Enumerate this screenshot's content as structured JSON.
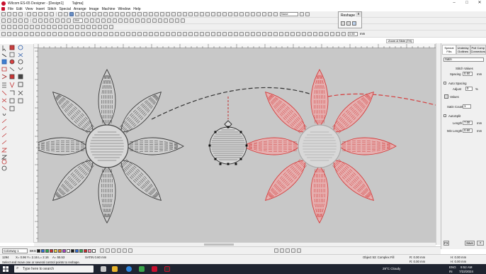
{
  "window": {
    "title": "Wilcom ES-65 Designer - [Design1]",
    "tab": "Tajima]"
  },
  "menu": [
    "File",
    "Edit",
    "View",
    "Insert",
    "Stitch",
    "Special",
    "Arrange",
    "Image",
    "Machine",
    "Window",
    "Help"
  ],
  "toolbar": {
    "mode_select": "None",
    "zoom_value": "254",
    "width_value": "0.50",
    "width_unit": "mm"
  },
  "reshape_toolbar": {
    "title": "Reshape",
    "close": "x"
  },
  "docker": {
    "top_tabs": [
      "Zoom & Slide (TH)",
      ""
    ],
    "tabs": [
      "Special Fills",
      "Underlay Outlines",
      "Pull Comp Connectors"
    ],
    "fill_type": "Satin",
    "section_stitch_values": "Stitch Values",
    "spacing_label": "Spacing",
    "spacing_value": "0.50",
    "spacing_unit": "mm",
    "auto_spacing_label": "Auto Spacing",
    "adjust_label": "Adjust",
    "adjust_value": "0",
    "adjust_unit": "%",
    "values_label": "Values",
    "satin_count_label": "Satin Count",
    "satin_count_value": "1",
    "autosplit_label": "AutoSplit",
    "length_label": "Length",
    "length_value": "7.00",
    "length_unit": "mm",
    "min_length_label": "Min Length",
    "min_length_value": "0.60",
    "min_length_unit": "mm",
    "fx_button": "FX",
    "save_button": "Save"
  },
  "colorbar": {
    "colorway": "Colorway 1",
    "bkg_label": "BKG",
    "swatches": [
      "#1a1a1a",
      "#2e6bd6",
      "#2ca84f",
      "#d12b2b",
      "#e8d34a",
      "#e07a1f",
      "#a63ec4",
      "#ffffff",
      "#1a1a1a",
      "#2e6bd6",
      "#2ca84f",
      "#d12b2b",
      "#ff8fb3",
      "#ffffff"
    ],
    "swatch_numbers": [
      "1",
      "2",
      "3",
      "4",
      "5",
      "6",
      "7",
      "8",
      "9",
      "10",
      "11",
      "12",
      "13",
      "14"
    ]
  },
  "status": {
    "stitch_count": "1294",
    "coord_x": "X= 0.96 Y= 2.16 L= 2.16",
    "angle": "A= 55.53",
    "stitch_type": "SATIN 0.60 mm",
    "help_text": "Select and move one or several control points to reshape.",
    "object": "Object 53: Complex Fill",
    "readouts": [
      "R: 0.00 mm",
      "R: 0.00 mm",
      "H: 0.00 mm",
      "H: 0.00 mm"
    ]
  },
  "taskbar": {
    "search_placeholder": "Type here to search",
    "weather": "29°C Cloudy",
    "lang": "ENG",
    "region": "IN",
    "time": "9:52 AM",
    "date": "7/22/2024"
  }
}
